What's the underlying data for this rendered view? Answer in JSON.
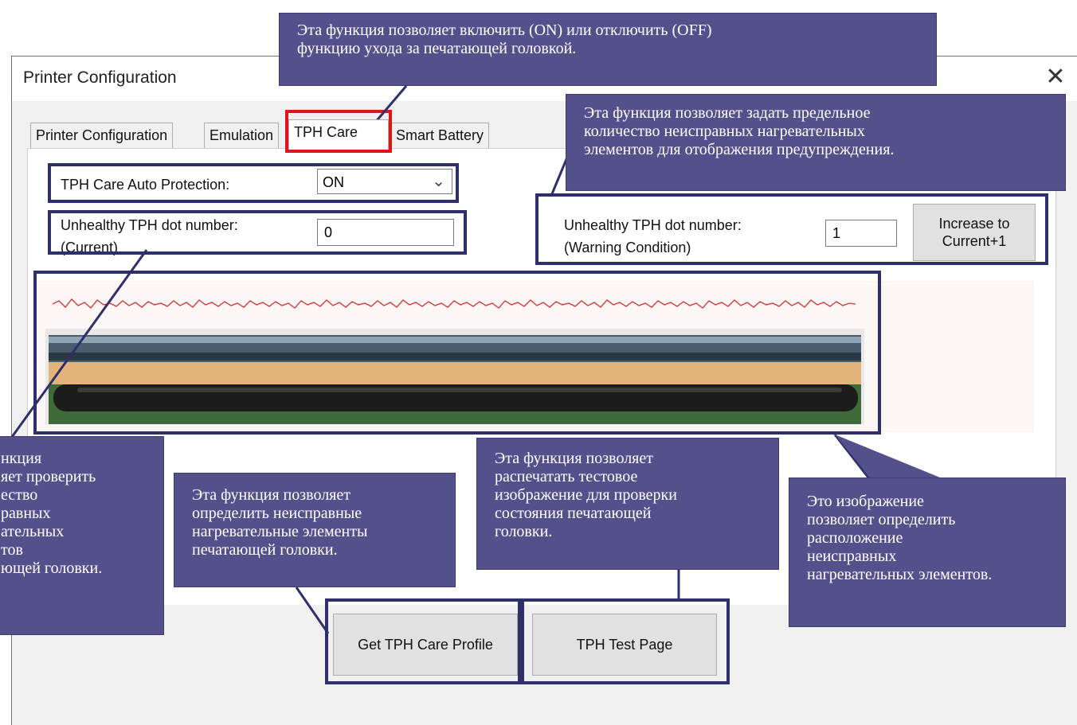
{
  "window": {
    "title": "Printer Configuration",
    "close_glyph": "✕"
  },
  "tabs": [
    {
      "label": "Printer Configuration"
    },
    {
      "label": "Emulation"
    },
    {
      "label": "TPH Care",
      "active": true
    },
    {
      "label": "Smart Battery"
    }
  ],
  "form": {
    "auto_protection_label": "TPH Care Auto Protection:",
    "auto_protection_value": "ON",
    "current_label_line1": "Unhealthy TPH dot number:",
    "current_label_line2": "(Current)",
    "current_value": "0",
    "warning_label_line1": "Unhealthy TPH dot number:",
    "warning_label_line2": "(Warning Condition)",
    "warning_value": "1",
    "increase_btn_line1": "Increase to",
    "increase_btn_line2": "Current+1",
    "get_profile_btn": "Get TPH Care Profile",
    "test_page_btn": "TPH Test Page"
  },
  "callouts": {
    "top": "Эта функция позволяет включить (ON) или отключить (OFF)\nфункцию ухода за печатающей головкой.",
    "top_right": "Эта функция позволяет задать предельное\nколичество неисправных нагревательных\nэлементов для отображения предупреждения.",
    "left": "нкция\nяет проверить\nество\nравных\nательных\nтов\nющей головки.",
    "mid_left": "Эта функция позволяет\nопределить неисправные\nнагревательные элементы\nпечатающей головки.",
    "mid_right": "Эта функция позволяет\nраспечатать тестовое\nизображение для проверки\nсостояния печатающей\nголовки.",
    "bottom_right": "Это изображение\nпозволяет определить\nрасположение\nнеисправных\nнагревательных элементов."
  },
  "colors": {
    "callout_bg": "#54508b",
    "highlight_red": "#e0151b",
    "outline": "#2f2f6b",
    "waveform": "#d43030"
  }
}
